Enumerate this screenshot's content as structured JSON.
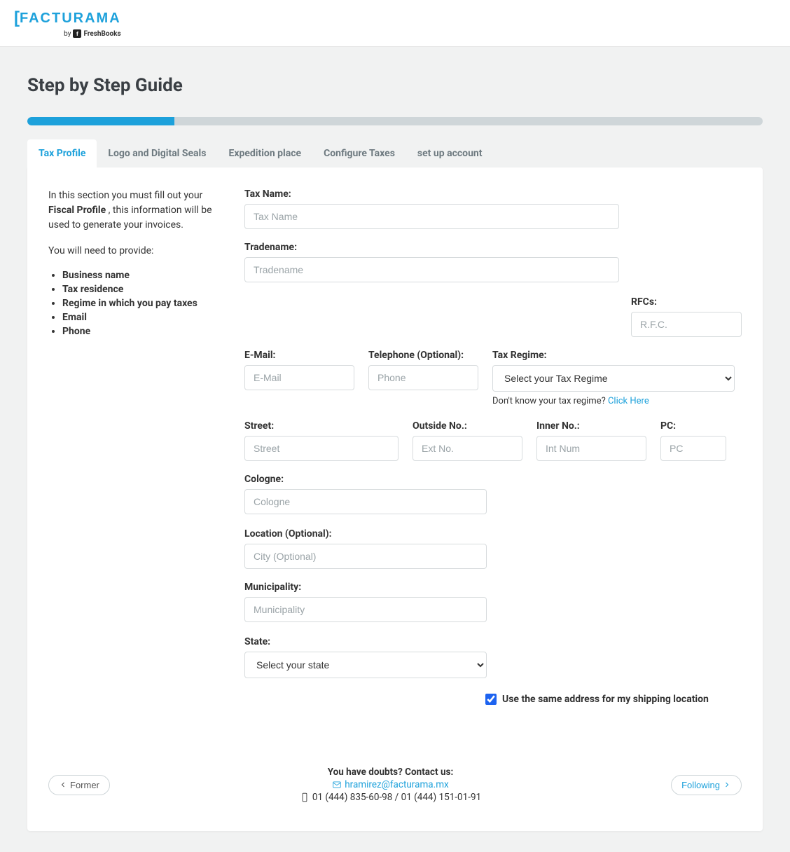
{
  "header": {
    "logo": "FACTURAMA",
    "sublogo_prefix": "by",
    "sublogo_brand": "FreshBooks"
  },
  "page": {
    "title": "Step by Step Guide",
    "progress_percent": 20
  },
  "tabs": [
    {
      "label": "Tax Profile",
      "active": true
    },
    {
      "label": "Logo and Digital Seals",
      "active": false
    },
    {
      "label": "Expedition place",
      "active": false
    },
    {
      "label": "Configure Taxes",
      "active": false
    },
    {
      "label": "set up account",
      "active": false
    }
  ],
  "sidebar": {
    "intro_prefix": "In this section you must fill out your ",
    "intro_bold": "Fiscal Profile",
    "intro_suffix": " , this information will be used to generate your invoices.",
    "need_text": "You will need to provide:",
    "items": [
      "Business name",
      "Tax residence",
      "Regime in which you pay taxes",
      "Email",
      "Phone"
    ]
  },
  "form": {
    "tax_name": {
      "label": "Tax Name:",
      "placeholder": "Tax Name",
      "value": ""
    },
    "tradename": {
      "label": "Tradename:",
      "placeholder": "Tradename",
      "value": ""
    },
    "rfc": {
      "label": "RFCs:",
      "placeholder": "R.F.C.",
      "value": ""
    },
    "email": {
      "label": "E-Mail:",
      "placeholder": "E-Mail",
      "value": ""
    },
    "phone": {
      "label": "Telephone (Optional):",
      "placeholder": "Phone",
      "value": ""
    },
    "tax_regime": {
      "label": "Tax Regime:",
      "selected": "Select your Tax Regime",
      "hint_text": "Don't know your tax regime? ",
      "hint_link": "Click Here"
    },
    "street": {
      "label": "Street:",
      "placeholder": "Street",
      "value": ""
    },
    "outside_no": {
      "label": "Outside No.:",
      "placeholder": "Ext No.",
      "value": ""
    },
    "inner_no": {
      "label": "Inner No.:",
      "placeholder": "Int Num",
      "value": ""
    },
    "pc": {
      "label": "PC:",
      "placeholder": "PC",
      "value": ""
    },
    "cologne": {
      "label": "Cologne:",
      "placeholder": "Cologne",
      "value": ""
    },
    "location": {
      "label": "Location (Optional):",
      "placeholder": "City (Optional)",
      "value": ""
    },
    "municipality": {
      "label": "Municipality:",
      "placeholder": "Municipality",
      "value": ""
    },
    "state": {
      "label": "State:",
      "selected": "Select your state"
    },
    "same_address": {
      "label": "Use the same address for my shipping location",
      "checked": true
    }
  },
  "footer": {
    "former_btn": "Former",
    "following_btn": "Following",
    "doubts_text": "You have doubts? Contact us:",
    "email": "hramirez@facturama.mx",
    "phones": "01 (444) 835-60-98 / 01 (444) 151-01-91"
  }
}
